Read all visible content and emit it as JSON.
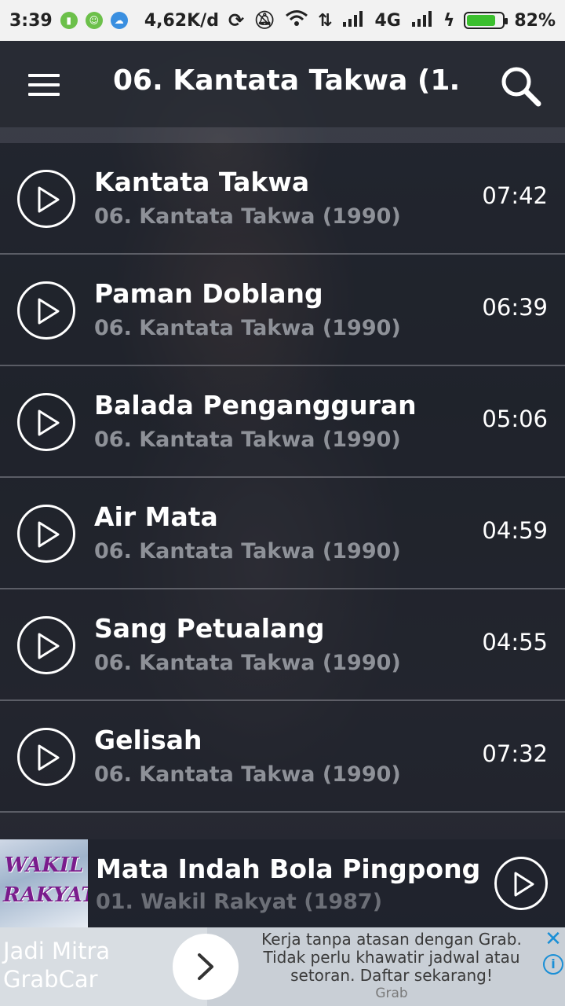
{
  "status_bar": {
    "time": "3:39",
    "network_speed": "4,62K/d",
    "network_type": "4G",
    "battery": "82%",
    "battery_level": 0.82,
    "notification_icons": [
      "sim-icon",
      "android-icon",
      "cloud-icon"
    ]
  },
  "app_bar": {
    "title": "06. Kantata Takwa (1…",
    "menu_icon": "hamburger-menu-icon",
    "search_icon": "search-icon"
  },
  "tracks": [
    {
      "title": "Kantata Takwa",
      "album": "06. Kantata Takwa (1990)",
      "duration": "07:42"
    },
    {
      "title": "Paman Doblang",
      "album": "06. Kantata Takwa (1990)",
      "duration": "06:39"
    },
    {
      "title": "Balada Pengangguran",
      "album": "06. Kantata Takwa (1990)",
      "duration": "05:06"
    },
    {
      "title": "Air Mata",
      "album": "06. Kantata Takwa (1990)",
      "duration": "04:59"
    },
    {
      "title": "Sang Petualang",
      "album": "06. Kantata Takwa (1990)",
      "duration": "04:55"
    },
    {
      "title": "Gelisah",
      "album": "06. Kantata Takwa (1990)",
      "duration": "07:32"
    }
  ],
  "now_playing": {
    "title": "Mata Indah Bola Pingpong",
    "album": "01. Wakil Rakyat (1987)",
    "cover_line1": "WAKIL",
    "cover_line2": "RAKYAT"
  },
  "ad": {
    "headline": "Jadi Mitra GrabCar",
    "body": "Kerja tanpa atasan dengan Grab. Tidak perlu khawatir jadwal atau setoran. Daftar sekarang!",
    "brand": "Grab",
    "close_icon": "close-icon",
    "info_icon": "info-icon"
  },
  "colors": {
    "background": "#23262f",
    "subtitle_gray": "#8e9198",
    "battery_green": "#3bbf2e",
    "ad_accent": "#1a8fd6"
  }
}
